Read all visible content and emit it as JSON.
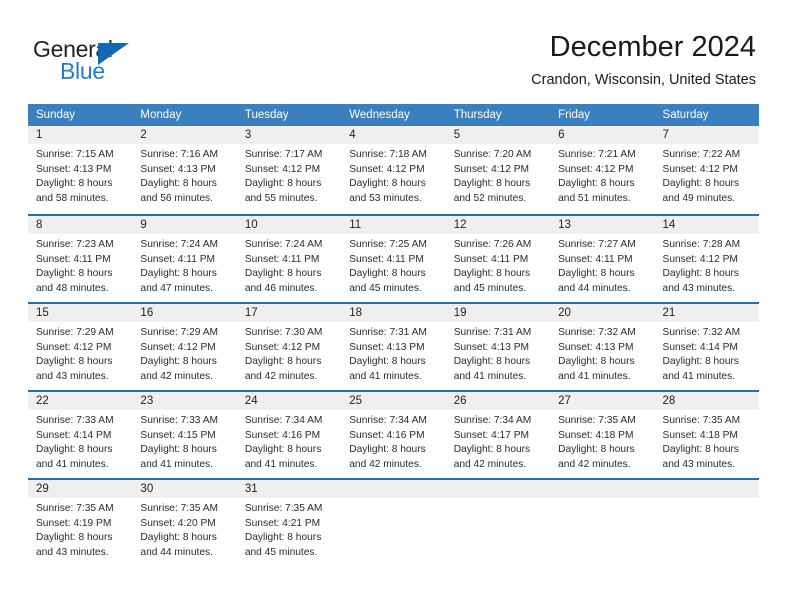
{
  "brand": {
    "name_top": "General",
    "name_bottom": "Blue",
    "color_dark": "#231f20",
    "color_blue": "#1f7fc4",
    "triangle_color": "#1268b3"
  },
  "header": {
    "month_title": "December 2024",
    "location": "Crandon, Wisconsin, United States"
  },
  "theme": {
    "header_bg": "#3b7fbe",
    "row_divider": "#2e6da4",
    "daynum_bg": "#efefef",
    "text": "#2b2b2b"
  },
  "weekday_headers": [
    "Sunday",
    "Monday",
    "Tuesday",
    "Wednesday",
    "Thursday",
    "Friday",
    "Saturday"
  ],
  "weeks": [
    [
      {
        "day": "1",
        "sunrise": "Sunrise: 7:15 AM",
        "sunset": "Sunset: 4:13 PM",
        "daylight_1": "Daylight: 8 hours",
        "daylight_2": "and 58 minutes."
      },
      {
        "day": "2",
        "sunrise": "Sunrise: 7:16 AM",
        "sunset": "Sunset: 4:13 PM",
        "daylight_1": "Daylight: 8 hours",
        "daylight_2": "and 56 minutes."
      },
      {
        "day": "3",
        "sunrise": "Sunrise: 7:17 AM",
        "sunset": "Sunset: 4:12 PM",
        "daylight_1": "Daylight: 8 hours",
        "daylight_2": "and 55 minutes."
      },
      {
        "day": "4",
        "sunrise": "Sunrise: 7:18 AM",
        "sunset": "Sunset: 4:12 PM",
        "daylight_1": "Daylight: 8 hours",
        "daylight_2": "and 53 minutes."
      },
      {
        "day": "5",
        "sunrise": "Sunrise: 7:20 AM",
        "sunset": "Sunset: 4:12 PM",
        "daylight_1": "Daylight: 8 hours",
        "daylight_2": "and 52 minutes."
      },
      {
        "day": "6",
        "sunrise": "Sunrise: 7:21 AM",
        "sunset": "Sunset: 4:12 PM",
        "daylight_1": "Daylight: 8 hours",
        "daylight_2": "and 51 minutes."
      },
      {
        "day": "7",
        "sunrise": "Sunrise: 7:22 AM",
        "sunset": "Sunset: 4:12 PM",
        "daylight_1": "Daylight: 8 hours",
        "daylight_2": "and 49 minutes."
      }
    ],
    [
      {
        "day": "8",
        "sunrise": "Sunrise: 7:23 AM",
        "sunset": "Sunset: 4:11 PM",
        "daylight_1": "Daylight: 8 hours",
        "daylight_2": "and 48 minutes."
      },
      {
        "day": "9",
        "sunrise": "Sunrise: 7:24 AM",
        "sunset": "Sunset: 4:11 PM",
        "daylight_1": "Daylight: 8 hours",
        "daylight_2": "and 47 minutes."
      },
      {
        "day": "10",
        "sunrise": "Sunrise: 7:24 AM",
        "sunset": "Sunset: 4:11 PM",
        "daylight_1": "Daylight: 8 hours",
        "daylight_2": "and 46 minutes."
      },
      {
        "day": "11",
        "sunrise": "Sunrise: 7:25 AM",
        "sunset": "Sunset: 4:11 PM",
        "daylight_1": "Daylight: 8 hours",
        "daylight_2": "and 45 minutes."
      },
      {
        "day": "12",
        "sunrise": "Sunrise: 7:26 AM",
        "sunset": "Sunset: 4:11 PM",
        "daylight_1": "Daylight: 8 hours",
        "daylight_2": "and 45 minutes."
      },
      {
        "day": "13",
        "sunrise": "Sunrise: 7:27 AM",
        "sunset": "Sunset: 4:11 PM",
        "daylight_1": "Daylight: 8 hours",
        "daylight_2": "and 44 minutes."
      },
      {
        "day": "14",
        "sunrise": "Sunrise: 7:28 AM",
        "sunset": "Sunset: 4:12 PM",
        "daylight_1": "Daylight: 8 hours",
        "daylight_2": "and 43 minutes."
      }
    ],
    [
      {
        "day": "15",
        "sunrise": "Sunrise: 7:29 AM",
        "sunset": "Sunset: 4:12 PM",
        "daylight_1": "Daylight: 8 hours",
        "daylight_2": "and 43 minutes."
      },
      {
        "day": "16",
        "sunrise": "Sunrise: 7:29 AM",
        "sunset": "Sunset: 4:12 PM",
        "daylight_1": "Daylight: 8 hours",
        "daylight_2": "and 42 minutes."
      },
      {
        "day": "17",
        "sunrise": "Sunrise: 7:30 AM",
        "sunset": "Sunset: 4:12 PM",
        "daylight_1": "Daylight: 8 hours",
        "daylight_2": "and 42 minutes."
      },
      {
        "day": "18",
        "sunrise": "Sunrise: 7:31 AM",
        "sunset": "Sunset: 4:13 PM",
        "daylight_1": "Daylight: 8 hours",
        "daylight_2": "and 41 minutes."
      },
      {
        "day": "19",
        "sunrise": "Sunrise: 7:31 AM",
        "sunset": "Sunset: 4:13 PM",
        "daylight_1": "Daylight: 8 hours",
        "daylight_2": "and 41 minutes."
      },
      {
        "day": "20",
        "sunrise": "Sunrise: 7:32 AM",
        "sunset": "Sunset: 4:13 PM",
        "daylight_1": "Daylight: 8 hours",
        "daylight_2": "and 41 minutes."
      },
      {
        "day": "21",
        "sunrise": "Sunrise: 7:32 AM",
        "sunset": "Sunset: 4:14 PM",
        "daylight_1": "Daylight: 8 hours",
        "daylight_2": "and 41 minutes."
      }
    ],
    [
      {
        "day": "22",
        "sunrise": "Sunrise: 7:33 AM",
        "sunset": "Sunset: 4:14 PM",
        "daylight_1": "Daylight: 8 hours",
        "daylight_2": "and 41 minutes."
      },
      {
        "day": "23",
        "sunrise": "Sunrise: 7:33 AM",
        "sunset": "Sunset: 4:15 PM",
        "daylight_1": "Daylight: 8 hours",
        "daylight_2": "and 41 minutes."
      },
      {
        "day": "24",
        "sunrise": "Sunrise: 7:34 AM",
        "sunset": "Sunset: 4:16 PM",
        "daylight_1": "Daylight: 8 hours",
        "daylight_2": "and 41 minutes."
      },
      {
        "day": "25",
        "sunrise": "Sunrise: 7:34 AM",
        "sunset": "Sunset: 4:16 PM",
        "daylight_1": "Daylight: 8 hours",
        "daylight_2": "and 42 minutes."
      },
      {
        "day": "26",
        "sunrise": "Sunrise: 7:34 AM",
        "sunset": "Sunset: 4:17 PM",
        "daylight_1": "Daylight: 8 hours",
        "daylight_2": "and 42 minutes."
      },
      {
        "day": "27",
        "sunrise": "Sunrise: 7:35 AM",
        "sunset": "Sunset: 4:18 PM",
        "daylight_1": "Daylight: 8 hours",
        "daylight_2": "and 42 minutes."
      },
      {
        "day": "28",
        "sunrise": "Sunrise: 7:35 AM",
        "sunset": "Sunset: 4:18 PM",
        "daylight_1": "Daylight: 8 hours",
        "daylight_2": "and 43 minutes."
      }
    ],
    [
      {
        "day": "29",
        "sunrise": "Sunrise: 7:35 AM",
        "sunset": "Sunset: 4:19 PM",
        "daylight_1": "Daylight: 8 hours",
        "daylight_2": "and 43 minutes."
      },
      {
        "day": "30",
        "sunrise": "Sunrise: 7:35 AM",
        "sunset": "Sunset: 4:20 PM",
        "daylight_1": "Daylight: 8 hours",
        "daylight_2": "and 44 minutes."
      },
      {
        "day": "31",
        "sunrise": "Sunrise: 7:35 AM",
        "sunset": "Sunset: 4:21 PM",
        "daylight_1": "Daylight: 8 hours",
        "daylight_2": "and 45 minutes."
      },
      {
        "day": "",
        "sunrise": "",
        "sunset": "",
        "daylight_1": "",
        "daylight_2": ""
      },
      {
        "day": "",
        "sunrise": "",
        "sunset": "",
        "daylight_1": "",
        "daylight_2": ""
      },
      {
        "day": "",
        "sunrise": "",
        "sunset": "",
        "daylight_1": "",
        "daylight_2": ""
      },
      {
        "day": "",
        "sunrise": "",
        "sunset": "",
        "daylight_1": "",
        "daylight_2": ""
      }
    ]
  ]
}
